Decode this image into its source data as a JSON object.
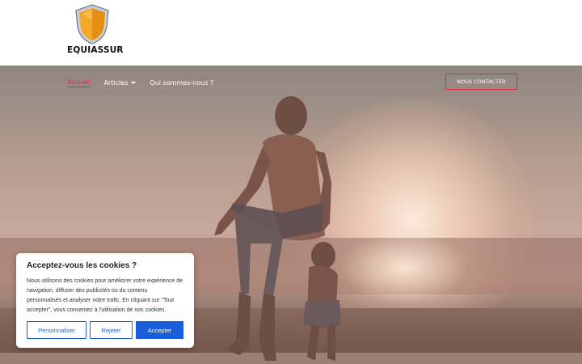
{
  "header": {
    "logo_text": "EQUIASSUR",
    "logo_icon": "shield-icon"
  },
  "nav": {
    "items": [
      {
        "label": "Accueil",
        "active": true
      },
      {
        "label": "Articles",
        "has_dropdown": true
      },
      {
        "label": "Qui sommes-nous ?"
      }
    ],
    "cta_label": "NOUS CONTACTER"
  },
  "cookie": {
    "title": "Acceptez-vous les cookies ?",
    "body": "Nous utilisons des cookies pour améliorer votre expérience de navigation, diffuser des publicités ou du contenu personnalisés et analyser notre trafic. En cliquant sur \"Tout accepter\", vous consentez à l'utilisation de nos cookies.",
    "buttons": {
      "customize": "Personnaliser",
      "reject": "Rejeter",
      "accept": "Accepter"
    }
  },
  "colors": {
    "accent": "#e02a44",
    "cookie_button": "#1a5fd9",
    "shield": "#f4a826"
  }
}
